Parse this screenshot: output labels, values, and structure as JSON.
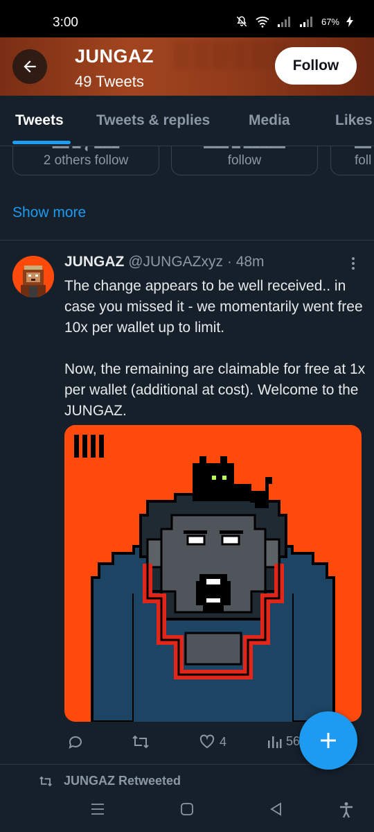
{
  "status": {
    "time": "3:00",
    "battery": "67%"
  },
  "header": {
    "title": "JUNGAZ",
    "tweet_count": "49 Tweets",
    "follow_label": "Follow"
  },
  "tabs": [
    {
      "label": "Tweets",
      "active": true
    },
    {
      "label": "Tweets & replies",
      "active": false
    },
    {
      "label": "Media",
      "active": false
    },
    {
      "label": "Likes",
      "active": false
    }
  ],
  "follower_cards": [
    {
      "line": "2 others follow"
    },
    {
      "line": "follow"
    },
    {
      "line": "foll"
    }
  ],
  "show_more": "Show more",
  "tweet": {
    "name": "JUNGAZ",
    "handle": "@JUNGAZxyz",
    "separator": "·",
    "time": "48m",
    "paragraph1": "The change appears to be well received.. in case you missed it - we momentarily went free 10x per wallet up to limit.",
    "paragraph2": "Now, the remaining are claimable for free at 1x per wallet (additional at cost). Welcome to the JUNGAZ.",
    "likes": "4",
    "views": "56"
  },
  "retweet_notice": "JUNGAZ Retweeted",
  "colors": {
    "accent": "#1d9bf0",
    "background": "#15202b",
    "media_bg": "#ff4a0c"
  }
}
